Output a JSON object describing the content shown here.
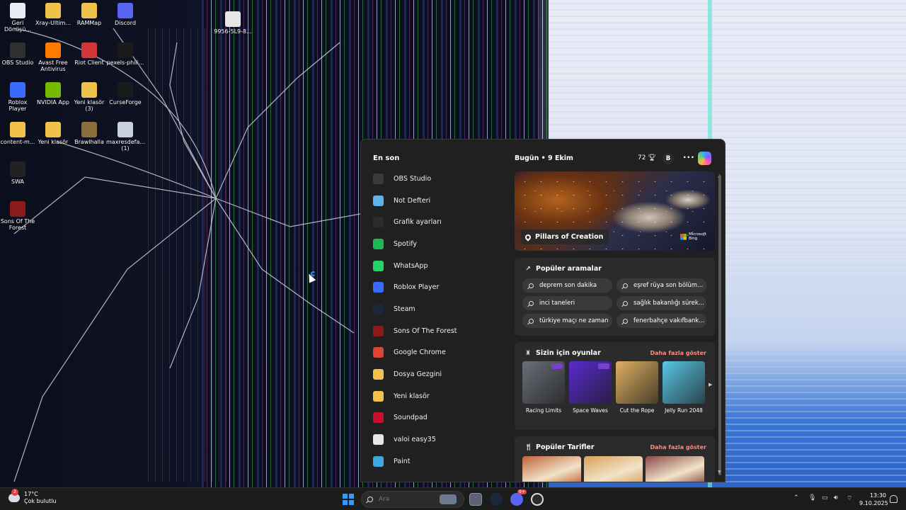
{
  "desktop": {
    "icons": [
      {
        "label": "Geri Dönüşü...",
        "icon": "recycle-bin-icon",
        "color": "#e8edf5"
      },
      {
        "label": "Xray-Ultim...",
        "icon": "folder-icon",
        "color": "#f0c24b"
      },
      {
        "label": "RAMMap",
        "icon": "folder-icon",
        "color": "#f0c24b"
      },
      {
        "label": "Discord",
        "icon": "discord-icon",
        "color": "#5865f2"
      },
      {
        "label": "9956-5L9-8...",
        "icon": "file-icon",
        "color": "#e6e6e6"
      },
      {
        "label": "OBS Studio",
        "icon": "obs-icon",
        "color": "#302e31"
      },
      {
        "label": "Avast Free Antivirus",
        "icon": "avast-icon",
        "color": "#ff7800"
      },
      {
        "label": "Riot Client",
        "icon": "riot-icon",
        "color": "#d13639"
      },
      {
        "label": "pexels-phili...",
        "icon": "image-file-icon",
        "color": "#1a1a1a"
      },
      {
        "label": "Roblox Player",
        "icon": "roblox-icon",
        "color": "#3a6bff"
      },
      {
        "label": "NVIDIA App",
        "icon": "nvidia-icon",
        "color": "#76b900"
      },
      {
        "label": "Yeni klasör (3)",
        "icon": "folder-icon",
        "color": "#f0c24b"
      },
      {
        "label": "CurseForge",
        "icon": "curseforge-icon",
        "color": "#1a1a1a"
      },
      {
        "label": "content-m...",
        "icon": "folder-icon",
        "color": "#f0c24b"
      },
      {
        "label": "Yeni klasör",
        "icon": "folder-icon",
        "color": "#f0c24b"
      },
      {
        "label": "Brawlhalla",
        "icon": "brawlhalla-icon",
        "color": "#8a6d3b"
      },
      {
        "label": "maxresdefa... (1)",
        "icon": "image-file-icon",
        "color": "#c8d0e0"
      },
      {
        "label": "SWA",
        "icon": "swa-icon",
        "color": "#222222"
      },
      {
        "label": "Sons Of The Forest",
        "icon": "sons-of-the-forest-icon",
        "color": "#8b1a1a"
      }
    ]
  },
  "start_menu": {
    "recent_title": "En son",
    "recent": [
      {
        "label": "OBS Studio",
        "icon": "obs-icon",
        "color": "#3a3a3a"
      },
      {
        "label": "Not Defteri",
        "icon": "notepad-icon",
        "color": "#5fb3e8"
      },
      {
        "label": "Grafik ayarları",
        "icon": "laptop-icon",
        "color": "#2b2b2b"
      },
      {
        "label": "Spotify",
        "icon": "spotify-icon",
        "color": "#1db954"
      },
      {
        "label": "WhatsApp",
        "icon": "whatsapp-icon",
        "color": "#25d366"
      },
      {
        "label": "Roblox Player",
        "icon": "roblox-icon",
        "color": "#3a6bff"
      },
      {
        "label": "Steam",
        "icon": "steam-icon",
        "color": "#1b2838"
      },
      {
        "label": "Sons Of The Forest",
        "icon": "sons-of-the-forest-icon",
        "color": "#8b1a1a"
      },
      {
        "label": "Google Chrome",
        "icon": "chrome-icon",
        "color": "#db4437"
      },
      {
        "label": "Dosya Gezgini",
        "icon": "file-explorer-icon",
        "color": "#f0c24b"
      },
      {
        "label": "Yeni klasör",
        "icon": "folder-icon",
        "color": "#f0c24b"
      },
      {
        "label": "Soundpad",
        "icon": "soundpad-icon",
        "color": "#c8102e"
      },
      {
        "label": "valoi easy35",
        "icon": "search-result-icon",
        "color": "#e6e6e6"
      },
      {
        "label": "Paint",
        "icon": "paint-icon",
        "color": "#3fa7e0"
      }
    ],
    "news": {
      "date_label": "Bugün",
      "date_sep": "•",
      "date_value": "9 Ekim",
      "temperature": "72",
      "temp_icon": "trophy-icon",
      "avatar_initial": "B",
      "more_icon": "more-options-icon",
      "hero": {
        "title": "Pillars of Creation",
        "brand": "Microsoft Bing"
      },
      "popular_searches": {
        "title": "Popüler aramalar",
        "items": [
          "deprem son dakika",
          "eşref rüya son bölüm...",
          "inci taneleri",
          "sağlık bakanlığı sürek...",
          "türkiye maçı ne zaman",
          "fenerbahçe vakıfbank..."
        ]
      },
      "games": {
        "title": "Sizin için oyunlar",
        "more": "Daha fazla göster",
        "items": [
          {
            "label": "Racing Limits",
            "color": "#6a6f78"
          },
          {
            "label": "Space Waves",
            "color": "#5a2ad0"
          },
          {
            "label": "Cut the Rope",
            "color": "#e0b060"
          },
          {
            "label": "Jelly Run 2048",
            "color": "#58c8e8"
          }
        ]
      },
      "recipes": {
        "title": "Popüler Tarifler",
        "more": "Daha fazla göster",
        "colors": [
          "#c0623a",
          "#d8a25a",
          "#8a4a4a"
        ]
      }
    }
  },
  "taskbar": {
    "weather_temp": "17°C",
    "weather_desc": "Çok bulutlu",
    "weather_badge": "2",
    "search_placeholder": "Ara",
    "discord_badge": "9+",
    "time": "13:30",
    "date": "9.10.2025"
  }
}
